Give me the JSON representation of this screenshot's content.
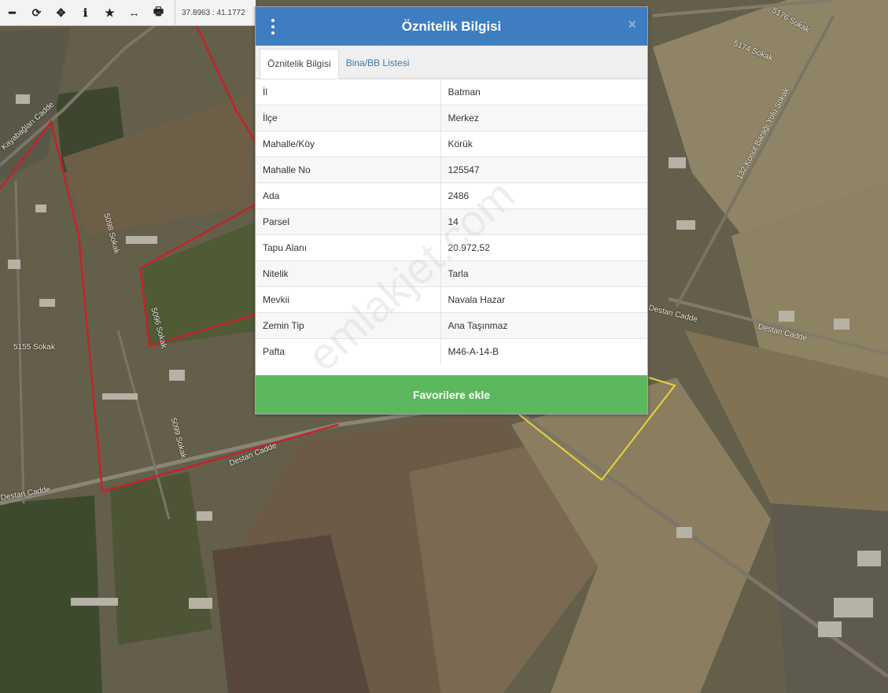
{
  "toolbar": {
    "tools": [
      {
        "name": "zoom-out-icon",
        "glyph": "━"
      },
      {
        "name": "refresh-icon",
        "glyph": "⟳"
      },
      {
        "name": "crosshair-icon",
        "glyph": "✥"
      },
      {
        "name": "info-icon",
        "glyph": "ℹ"
      },
      {
        "name": "star-icon",
        "glyph": "★"
      },
      {
        "name": "measure-icon",
        "glyph": "↔"
      },
      {
        "name": "print-icon",
        "glyph": "🖶"
      }
    ],
    "coordinates": "37.8963 : 41.1772"
  },
  "modal": {
    "title": "Öznitelik Bilgisi",
    "close": "×",
    "tabs": [
      {
        "label": "Öznitelik Bilgisi",
        "active": true
      },
      {
        "label": "Bina/BB Listesi",
        "active": false
      }
    ],
    "rows": [
      {
        "key": "İl",
        "value": "Batman"
      },
      {
        "key": "İlçe",
        "value": "Merkez"
      },
      {
        "key": "Mahalle/Köy",
        "value": "Körük"
      },
      {
        "key": "Mahalle No",
        "value": "125547"
      },
      {
        "key": "Ada",
        "value": "2486"
      },
      {
        "key": "Parsel",
        "value": "14"
      },
      {
        "key": "Tapu Alanı",
        "value": "20.972,52"
      },
      {
        "key": "Nitelik",
        "value": "Tarla"
      },
      {
        "key": "Mevkii",
        "value": "Navala Hazar"
      },
      {
        "key": "Zemin Tip",
        "value": "Ana Taşınmaz"
      },
      {
        "key": "Pafta",
        "value": "M46-A-14-B"
      }
    ],
    "favorite_button": "Favorilere ekle"
  },
  "map": {
    "streets": [
      "Kayabağları Cadde",
      "5155 Sokak",
      "Destan Cadde",
      "Destan Cadde",
      "Destan Cadde",
      "5174 Sokak",
      "5176 Sokak",
      "132.Konut Barağı Yolu Sokak",
      "Destan Cadde",
      "5098 Sokak",
      "5096 Sokak",
      "5099 Sokak"
    ]
  },
  "watermark": "emlakjet.com",
  "colors": {
    "header": "#3f7dc1",
    "favorite": "#5cb85c",
    "parcel_outline": "#c4222b",
    "selected_parcel": "#e7d43a"
  }
}
